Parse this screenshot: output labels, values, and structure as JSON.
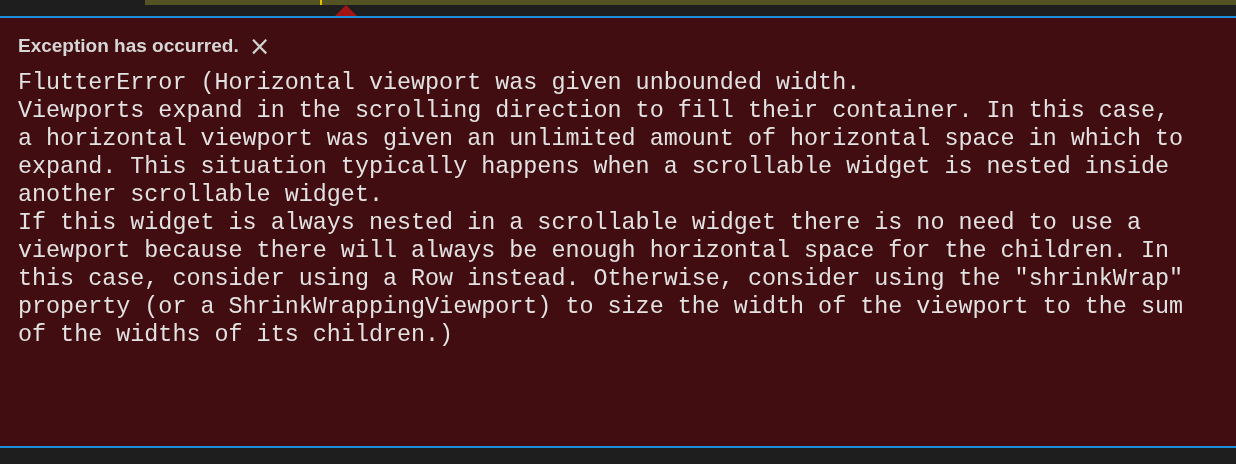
{
  "exception_widget": {
    "title": "Exception has occurred.",
    "close_label": "×",
    "message_lines": [
      "FlutterError (Horizontal viewport was given unbounded width.",
      "Viewports expand in the scrolling direction to fill their container. In this case,",
      "a horizontal viewport was given an unlimited amount of horizontal space in which to",
      "expand. This situation typically happens when a scrollable widget is nested inside",
      "another scrollable widget.",
      "If this widget is always nested in a scrollable widget there is no need to use a",
      "viewport because there will always be enough horizontal space for the children. In",
      "this case, consider using a Row instead. Otherwise, consider using the \"shrinkWrap\"",
      "property (or a ShrinkWrappingViewport) to size the width of the viewport to the sum",
      "of the widths of its children.)"
    ]
  }
}
